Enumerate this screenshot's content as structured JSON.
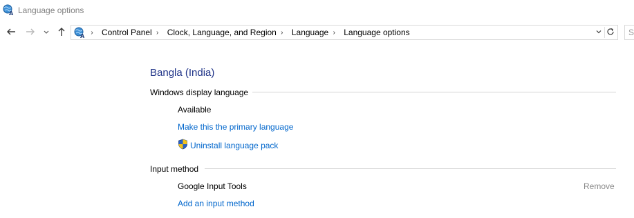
{
  "window": {
    "title": "Language options",
    "title_icon": "globe-language-icon"
  },
  "nav": {
    "back_icon": "arrow-left-icon",
    "forward_icon": "arrow-right-icon",
    "recent_icon": "chevron-down-icon",
    "up_icon": "arrow-up-icon"
  },
  "address": {
    "icon": "globe-language-icon",
    "breadcrumbs": [
      "Control Panel",
      "Clock, Language, and Region",
      "Language",
      "Language options"
    ],
    "dropdown_icon": "chevron-down-icon",
    "refresh_icon": "refresh-icon",
    "search_placeholder": "S"
  },
  "language": {
    "name": "Bangla (India)",
    "display_section": {
      "heading": "Windows display language",
      "status": "Available",
      "make_primary_link": "Make this the primary language",
      "uninstall_link": "Uninstall language pack",
      "uninstall_icon": "uac-shield-icon"
    },
    "input_section": {
      "heading": "Input method",
      "methods": [
        {
          "name": "Google Input Tools",
          "remove_label": "Remove"
        }
      ],
      "add_link": "Add an input method"
    }
  },
  "colors": {
    "title_blue": "#1e3287",
    "link_blue": "#0066cc",
    "muted_gray": "#8a8a8a",
    "rule_gray": "#d5d5d5"
  }
}
